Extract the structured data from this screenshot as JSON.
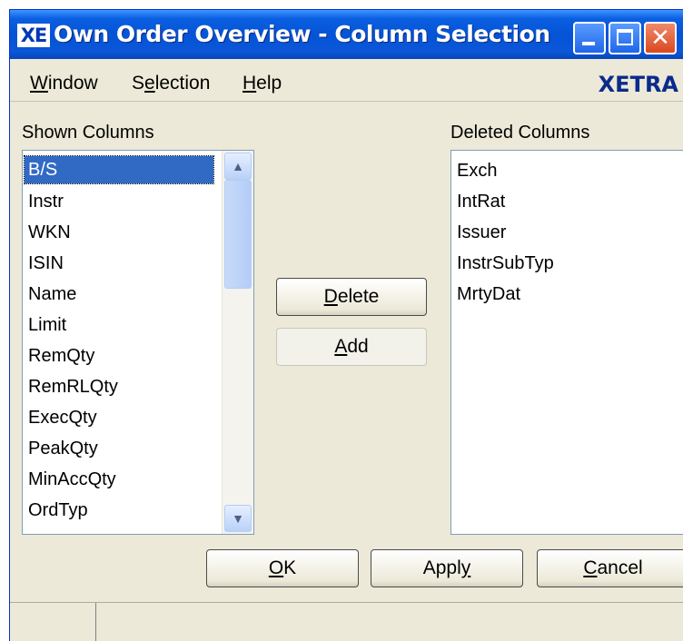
{
  "window": {
    "title": "Own Order Overview - Column Selection",
    "logo": "XE",
    "controls": [
      "minimize-icon",
      "maximize-icon",
      "close-icon"
    ]
  },
  "menu": {
    "items": [
      {
        "label": "Window",
        "mnemonic": "W",
        "rest": "indow"
      },
      {
        "label": "Selection",
        "pre": "S",
        "mnemonic": "e",
        "rest": "lection"
      },
      {
        "label": "Help",
        "mnemonic": "H",
        "rest": "elp"
      }
    ],
    "brand": "XETRA"
  },
  "shown": {
    "label": "Shown Columns",
    "items": [
      "B/S",
      "Instr",
      "WKN",
      "ISIN",
      "Name",
      "Limit",
      "RemQty",
      "RemRLQty",
      "ExecQty",
      "PeakQty",
      "MinAccQty",
      "OrdTyp"
    ],
    "selected_index": 0
  },
  "deleted": {
    "label": "Deleted Columns",
    "items": [
      "Exch",
      "IntRat",
      "Issuer",
      "InstrSubTyp",
      "MrtyDat"
    ]
  },
  "buttons": {
    "delete": {
      "mnemonic": "D",
      "rest": "elete"
    },
    "add": {
      "mnemonic": "A",
      "rest": "dd"
    },
    "ok": {
      "mnemonic": "O",
      "rest": "K"
    },
    "apply": {
      "pre": "Appl",
      "mnemonic": "y"
    },
    "cancel": {
      "mnemonic": "C",
      "rest": "ancel"
    }
  },
  "colors": {
    "accent": "#0553d6",
    "selection": "#316ac5",
    "brand": "#0a2a8c"
  }
}
